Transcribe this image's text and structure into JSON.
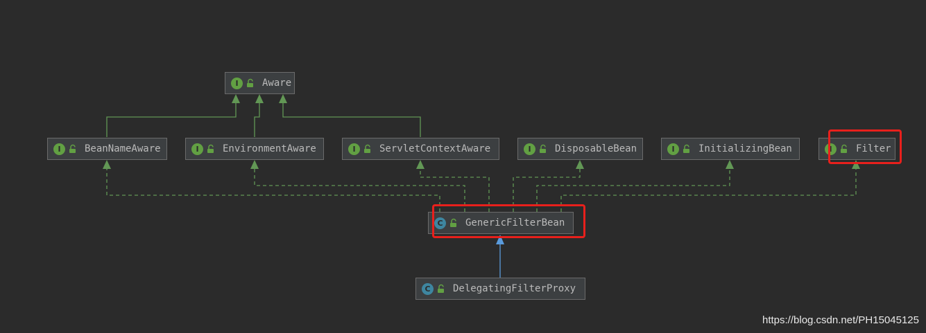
{
  "nodes": {
    "aware": {
      "label": "Aware",
      "kind": "I"
    },
    "bean_name_aware": {
      "label": "BeanNameAware",
      "kind": "I"
    },
    "environment_aware": {
      "label": "EnvironmentAware",
      "kind": "I"
    },
    "servlet_context_aware": {
      "label": "ServletContextAware",
      "kind": "I"
    },
    "disposable_bean": {
      "label": "DisposableBean",
      "kind": "I"
    },
    "initializing_bean": {
      "label": "InitializingBean",
      "kind": "I"
    },
    "filter": {
      "label": "Filter",
      "kind": "I"
    },
    "generic_filter_bean": {
      "label": "GenericFilterBean",
      "kind": "C"
    },
    "delegating_filter_proxy": {
      "label": "DelegatingFilterProxy",
      "kind": "C"
    }
  },
  "edges": [
    {
      "from": "bean_name_aware",
      "to": "aware",
      "type": "extends"
    },
    {
      "from": "environment_aware",
      "to": "aware",
      "type": "extends"
    },
    {
      "from": "servlet_context_aware",
      "to": "aware",
      "type": "extends"
    },
    {
      "from": "generic_filter_bean",
      "to": "bean_name_aware",
      "type": "implements"
    },
    {
      "from": "generic_filter_bean",
      "to": "environment_aware",
      "type": "implements"
    },
    {
      "from": "generic_filter_bean",
      "to": "servlet_context_aware",
      "type": "implements"
    },
    {
      "from": "generic_filter_bean",
      "to": "disposable_bean",
      "type": "implements"
    },
    {
      "from": "generic_filter_bean",
      "to": "initializing_bean",
      "type": "implements"
    },
    {
      "from": "generic_filter_bean",
      "to": "filter",
      "type": "implements"
    },
    {
      "from": "delegating_filter_proxy",
      "to": "generic_filter_bean",
      "type": "class-extends"
    }
  ],
  "highlighted": [
    "filter",
    "generic_filter_bean"
  ],
  "colors": {
    "background": "#2b2b2b",
    "node_fill": "#3c3f41",
    "node_border": "#6b6b6b",
    "text": "#bbbbbb",
    "interface_badge": "#62a043",
    "class_badge": "#3e86a0",
    "extends_line": "#629755",
    "class_extends_line": "#5a9bdc",
    "highlight": "#e8201c"
  },
  "icons": {
    "interface": "interface-badge-icon",
    "class": "class-badge-icon",
    "access": "public-lock-icon"
  },
  "watermark": "https://blog.csdn.net/PH15045125"
}
